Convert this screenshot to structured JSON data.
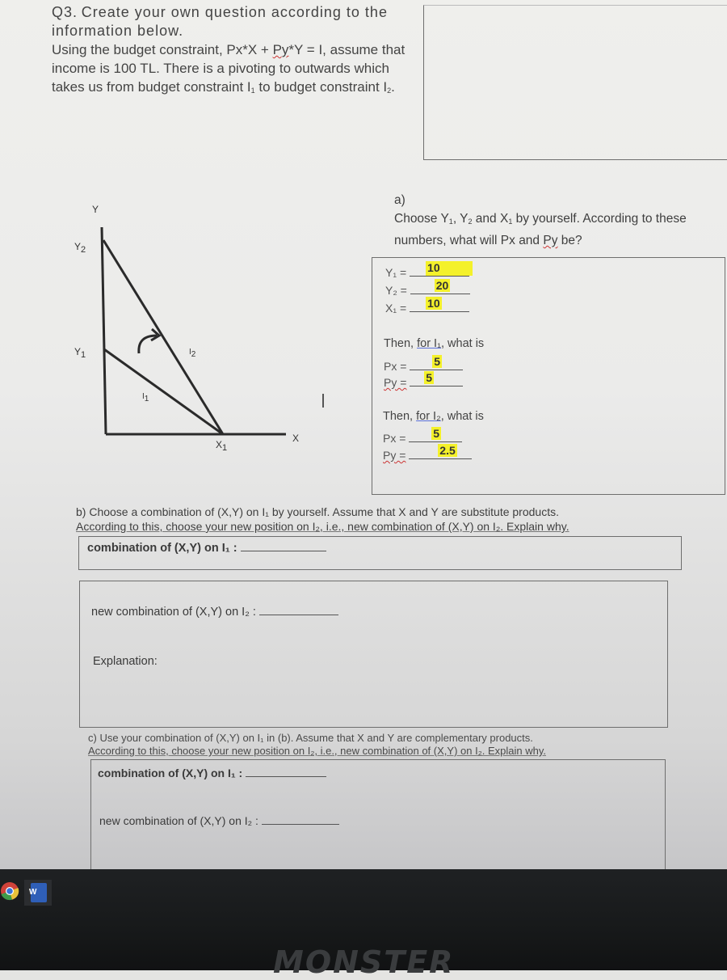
{
  "question": {
    "number": "Q3.",
    "intro_line1": "Create your own question according to the information below.",
    "intro_line2_pre": "Using the budget constraint, Px*X + ",
    "intro_py": "Py",
    "intro_line2_post": "*Y = I, assume that income is 100 TL. There is a pivoting to outwards which takes us from budget constraint I",
    "sub1": "1",
    "intro_mid": " to budget constraint I",
    "sub2": "2",
    "intro_end": "."
  },
  "graph": {
    "y_axis_label": "Y",
    "x_axis_label": "X",
    "y2_label": "Y",
    "y2_sub": "2",
    "y1_label": "Y",
    "y1_sub": "1",
    "x1_label": "X",
    "x1_sub": "1",
    "i1_label": "I",
    "i1_sub": "1",
    "i2_label": "I",
    "i2_sub": "2",
    "pivot_arrow": "curved-arrow-icon"
  },
  "part_a": {
    "label": "a)",
    "prompt_pre": "Choose Y",
    "prompt_mid1": ", Y",
    "prompt_mid2": " and X",
    "prompt_post": " by yourself. According to these numbers, what will Px and ",
    "prompt_py": "Py",
    "prompt_end": " be?",
    "answers": {
      "y1_label": "Y₁ =",
      "y1_value": "10",
      "y2_label": "Y₂ =",
      "y2_value": "20",
      "x1_label": "X₁ =",
      "x1_value": "10"
    },
    "i1_heading_pre": "Then, ",
    "i1_heading_for": "for  I₁",
    "i1_heading_post": ", what is",
    "i1_px_label": "Px =",
    "i1_px_value": "5",
    "i1_py_label": "Py =",
    "i1_py_value": "5",
    "i2_heading_pre": "Then, ",
    "i2_heading_for": "for  I₂",
    "i2_heading_post": ", what is",
    "i2_px_label": "Px =",
    "i2_px_value": "5",
    "i2_py_label": "Py =",
    "i2_py_value": "2.5"
  },
  "part_b": {
    "line1": "b) Choose a combination of (X,Y) on I₁ by yourself. Assume that X and Y are substitute products.",
    "line2": "According to this, choose your new position on I₂, i.e., new combination of (X,Y) on I₂. Explain why.",
    "combo_label": "combination of (X,Y) on I₁ :",
    "new_combo_label": "new combination of (X,Y) on I₂ :",
    "explanation_label": "Explanation:"
  },
  "part_c": {
    "line1": "c) Use your combination of (X,Y) on I₁ in (b). Assume that X and Y are complementary products.",
    "line2": "According to this, choose your new position on I₂, i.e., new combination of (X,Y) on I₂. Explain why.",
    "combo_label": "combination of (X,Y) on I₁ :",
    "new_combo_label": "new combination of (X,Y) on I₂ :"
  },
  "taskbar": {
    "apps": [
      "chrome-icon",
      "word-icon"
    ],
    "word_letter": "W",
    "monitor_brand": "MONSTER"
  },
  "colors": {
    "highlight": "#f4f12a",
    "spell_error": "#cc3333",
    "grammar_underline": "#5a6fd8"
  }
}
